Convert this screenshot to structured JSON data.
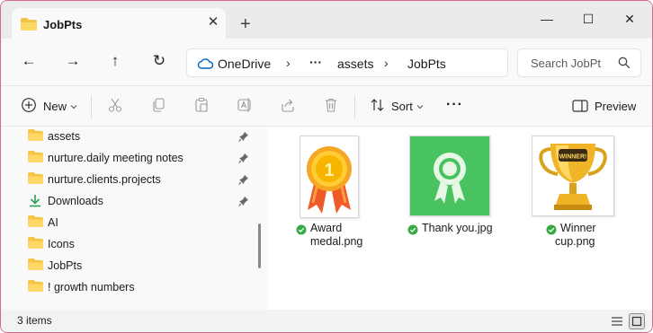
{
  "window": {
    "tab_title": "JobPts",
    "close_tab_glyph": "✕",
    "new_tab_glyph": "+",
    "minimize_glyph": "—",
    "maximize_glyph": "☐",
    "close_glyph": "✕"
  },
  "nav": {
    "back_glyph": "←",
    "forward_glyph": "→",
    "up_glyph": "↑",
    "refresh_glyph": "↻",
    "breadcrumbs": [
      "OneDrive",
      "···",
      "assets",
      "JobPts"
    ],
    "chevron_glyph": "›",
    "search_placeholder": "Search JobPt"
  },
  "toolbar": {
    "new_label": "New",
    "sort_label": "Sort",
    "more_glyph": "···",
    "preview_label": "Preview"
  },
  "sidebar": {
    "items": [
      {
        "label": "assets",
        "icon": "folder-icon",
        "pinned": true
      },
      {
        "label": "nurture.daily meeting notes",
        "icon": "folder-icon",
        "pinned": true
      },
      {
        "label": "nurture.clients.projects",
        "icon": "folder-icon",
        "pinned": true
      },
      {
        "label": "Downloads",
        "icon": "download-icon",
        "pinned": true
      },
      {
        "label": "AI",
        "icon": "folder-icon",
        "pinned": false
      },
      {
        "label": "Icons",
        "icon": "folder-icon",
        "pinned": false
      },
      {
        "label": "JobPts",
        "icon": "folder-icon",
        "pinned": false
      },
      {
        "label": "! growth numbers",
        "icon": "folder-icon",
        "pinned": false
      }
    ]
  },
  "files": [
    {
      "line1": "Award",
      "line2": "medal.png",
      "thumb": "award-medal-thumbnail"
    },
    {
      "line1": "Thank you.jpg",
      "line2": "",
      "thumb": "thank-you-thumbnail"
    },
    {
      "line1": "Winner",
      "line2": "cup.png",
      "thumb": "winner-cup-thumbnail",
      "cup_text": "WINNER!"
    }
  ],
  "status": {
    "item_count": "3 items"
  },
  "colors": {
    "accent": "#0067c0",
    "folder": "#f4c542",
    "sync_green": "#3aa845",
    "window_border": "#d36a8f"
  }
}
